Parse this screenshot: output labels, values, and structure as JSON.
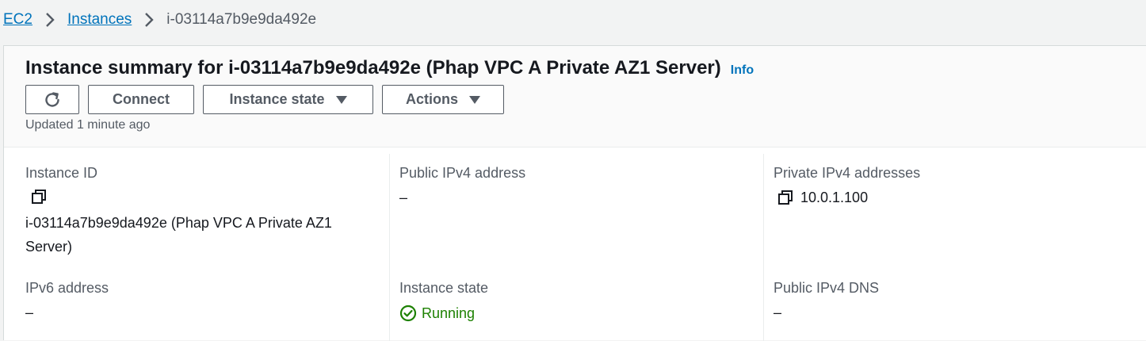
{
  "breadcrumb": {
    "items": [
      "EC2",
      "Instances"
    ],
    "current": "i-03114a7b9e9da492e"
  },
  "header": {
    "title": "Instance summary for i-03114a7b9e9da492e (Phap VPC A Private AZ1 Server)",
    "info": "Info",
    "buttons": {
      "connect": "Connect",
      "instance_state": "Instance state",
      "actions": "Actions"
    },
    "updated": "Updated 1 minute ago"
  },
  "details": {
    "instance_id": {
      "label": "Instance ID",
      "value_line1": "i-03114a7b9e9da492e (Phap VPC A Private AZ1",
      "value_line2": "Server)"
    },
    "public_ipv4": {
      "label": "Public IPv4 address",
      "value": "–"
    },
    "private_ipv4": {
      "label": "Private IPv4 addresses",
      "value": "10.0.1.100"
    },
    "ipv6": {
      "label": "IPv6 address",
      "value": "–"
    },
    "instance_state": {
      "label": "Instance state",
      "value": "Running"
    },
    "public_dns": {
      "label": "Public IPv4 DNS",
      "value": "–"
    }
  },
  "colors": {
    "link": "#0073bb",
    "success": "#1d8102",
    "text": "#16191f",
    "muted": "#545b64"
  },
  "icons": [
    "chevron-right-icon",
    "refresh-icon",
    "caret-down-icon",
    "copy-icon",
    "check-circle-icon"
  ]
}
